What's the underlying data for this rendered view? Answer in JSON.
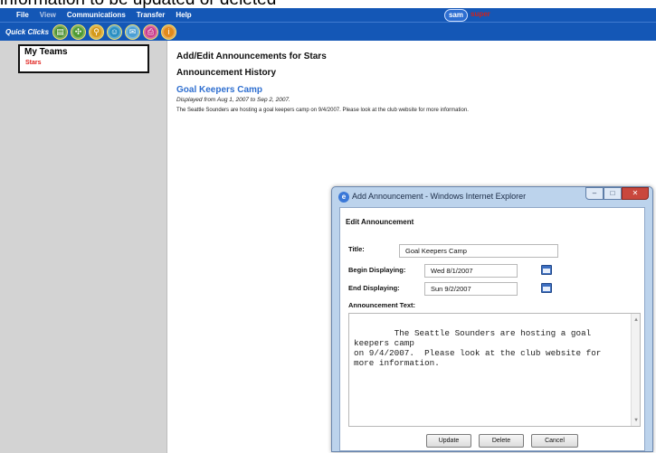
{
  "caption": "information to be updated or deleted",
  "menu": {
    "items": [
      "File",
      "View",
      "Communications",
      "Transfer",
      "Help"
    ],
    "user_badge": "sam",
    "user_role": "super"
  },
  "quick_clicks": {
    "label": "Quick Clicks",
    "icons": [
      "calendar-icon",
      "team-icon",
      "search-icon",
      "users-icon",
      "messages-icon",
      "print-icon",
      "info-icon"
    ]
  },
  "sidebar": {
    "title": "My Teams",
    "items": [
      "Stars"
    ]
  },
  "main": {
    "heading": "Add/Edit Announcements for Stars",
    "subheading": "Announcement History",
    "announcement": {
      "title": "Goal Keepers Camp",
      "dates": "Displayed from Aug 1, 2007 to Sep 2, 2007.",
      "body": "The Seattle Sounders are hosting a goal keepers camp on 9/4/2007. Please look at the club website for more information."
    }
  },
  "dialog": {
    "window_title": "Add Announcement - Windows Internet Explorer",
    "heading": "Edit Announcement",
    "title_label": "Title:",
    "title_value": "Goal Keepers Camp",
    "begin_label": "Begin Displaying:",
    "begin_value": "Wed 8/1/2007",
    "end_label": "End Displaying:",
    "end_value": "Sun 9/2/2007",
    "text_label": "Announcement Text:",
    "text_value": "The Seattle Sounders are hosting a goal keepers camp\non 9/4/2007.  Please look at the club website for\nmore information.",
    "buttons": {
      "update": "Update",
      "delete": "Delete",
      "cancel": "Cancel"
    }
  }
}
